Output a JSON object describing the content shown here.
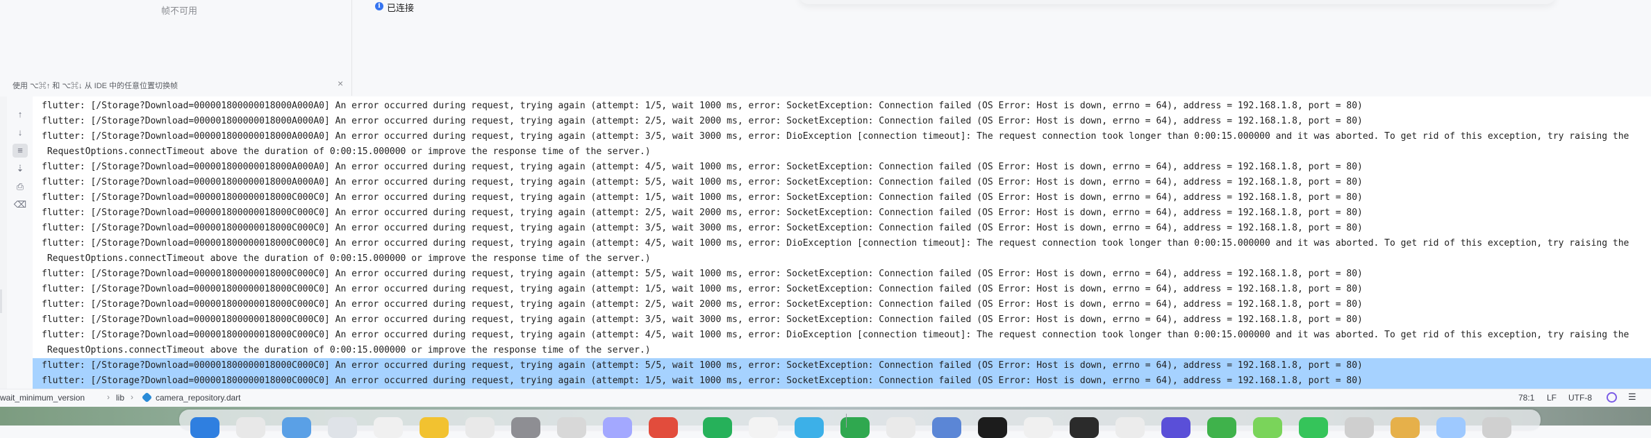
{
  "top_panel": {
    "frame_status": "帧不可用",
    "ide_hint": "使用 ⌥⌘↑ 和 ⌥⌘↓ 从 IDE 中的任意位置切换帧",
    "close_icon": "close-icon",
    "connection_status": "已连接",
    "info_icon": "info-icon"
  },
  "console_toolbar": [
    {
      "name": "scroll-up-icon",
      "glyph": "↑"
    },
    {
      "name": "scroll-down-icon",
      "glyph": "↓"
    },
    {
      "name": "soft-wrap-icon",
      "glyph": "≡"
    },
    {
      "name": "scroll-to-end-icon",
      "glyph": "⇣"
    },
    {
      "name": "print-icon",
      "glyph": "⎙"
    },
    {
      "name": "trash-icon",
      "glyph": "🗑"
    }
  ],
  "console": {
    "lines": [
      {
        "text": "flutter: [/Storage?Download=000001800000018000A000A0] An error occurred during request, trying again (attempt: 1/5, wait 1000 ms, error: SocketException: Connection failed (OS Error: Host is down, errno = 64), address = 192.168.1.8, port = 80)",
        "selected": false
      },
      {
        "text": "flutter: [/Storage?Download=000001800000018000A000A0] An error occurred during request, trying again (attempt: 2/5, wait 2000 ms, error: SocketException: Connection failed (OS Error: Host is down, errno = 64), address = 192.168.1.8, port = 80)",
        "selected": false
      },
      {
        "text": "flutter: [/Storage?Download=000001800000018000A000A0] An error occurred during request, trying again (attempt: 3/5, wait 3000 ms, error: DioException [connection timeout]: The request connection took longer than 0:00:15.000000 and it was aborted. To get rid of this exception, try raising the",
        "selected": false
      },
      {
        "text": " RequestOptions.connectTimeout above the duration of 0:00:15.000000 or improve the response time of the server.)",
        "selected": false
      },
      {
        "text": "flutter: [/Storage?Download=000001800000018000A000A0] An error occurred during request, trying again (attempt: 4/5, wait 1000 ms, error: SocketException: Connection failed (OS Error: Host is down, errno = 64), address = 192.168.1.8, port = 80)",
        "selected": false
      },
      {
        "text": "flutter: [/Storage?Download=000001800000018000A000A0] An error occurred during request, trying again (attempt: 5/5, wait 1000 ms, error: SocketException: Connection failed (OS Error: Host is down, errno = 64), address = 192.168.1.8, port = 80)",
        "selected": false
      },
      {
        "text": "flutter: [/Storage?Download=000001800000018000C000C0] An error occurred during request, trying again (attempt: 1/5, wait 1000 ms, error: SocketException: Connection failed (OS Error: Host is down, errno = 64), address = 192.168.1.8, port = 80)",
        "selected": false
      },
      {
        "text": "flutter: [/Storage?Download=000001800000018000C000C0] An error occurred during request, trying again (attempt: 2/5, wait 2000 ms, error: SocketException: Connection failed (OS Error: Host is down, errno = 64), address = 192.168.1.8, port = 80)",
        "selected": false
      },
      {
        "text": "flutter: [/Storage?Download=000001800000018000C000C0] An error occurred during request, trying again (attempt: 3/5, wait 3000 ms, error: SocketException: Connection failed (OS Error: Host is down, errno = 64), address = 192.168.1.8, port = 80)",
        "selected": false
      },
      {
        "text": "flutter: [/Storage?Download=000001800000018000C000C0] An error occurred during request, trying again (attempt: 4/5, wait 1000 ms, error: DioException [connection timeout]: The request connection took longer than 0:00:15.000000 and it was aborted. To get rid of this exception, try raising the",
        "selected": false
      },
      {
        "text": " RequestOptions.connectTimeout above the duration of 0:00:15.000000 or improve the response time of the server.)",
        "selected": false
      },
      {
        "text": "flutter: [/Storage?Download=000001800000018000C000C0] An error occurred during request, trying again (attempt: 5/5, wait 1000 ms, error: SocketException: Connection failed (OS Error: Host is down, errno = 64), address = 192.168.1.8, port = 80)",
        "selected": false
      },
      {
        "text": "flutter: [/Storage?Download=000001800000018000C000C0] An error occurred during request, trying again (attempt: 1/5, wait 1000 ms, error: SocketException: Connection failed (OS Error: Host is down, errno = 64), address = 192.168.1.8, port = 80)",
        "selected": false
      },
      {
        "text": "flutter: [/Storage?Download=000001800000018000C000C0] An error occurred during request, trying again (attempt: 2/5, wait 2000 ms, error: SocketException: Connection failed (OS Error: Host is down, errno = 64), address = 192.168.1.8, port = 80)",
        "selected": false
      },
      {
        "text": "flutter: [/Storage?Download=000001800000018000C000C0] An error occurred during request, trying again (attempt: 3/5, wait 3000 ms, error: SocketException: Connection failed (OS Error: Host is down, errno = 64), address = 192.168.1.8, port = 80)",
        "selected": false
      },
      {
        "text": "flutter: [/Storage?Download=000001800000018000C000C0] An error occurred during request, trying again (attempt: 4/5, wait 1000 ms, error: DioException [connection timeout]: The request connection took longer than 0:00:15.000000 and it was aborted. To get rid of this exception, try raising the",
        "selected": false
      },
      {
        "text": " RequestOptions.connectTimeout above the duration of 0:00:15.000000 or improve the response time of the server.)",
        "selected": false
      },
      {
        "text": "flutter: [/Storage?Download=000001800000018000C000C0] An error occurred during request, trying again (attempt: 5/5, wait 1000 ms, error: SocketException: Connection failed (OS Error: Host is down, errno = 64), address = 192.168.1.8, port = 80)",
        "selected": true
      },
      {
        "text": "flutter: [/Storage?Download=000001800000018000C000C0] An error occurred during request, trying again (attempt: 1/5, wait 1000 ms, error: SocketException: Connection failed (OS Error: Host is down, errno = 64), address = 192.168.1.8, port = 80)",
        "selected": true
      }
    ]
  },
  "statusbar": {
    "breadcrumb": [
      "wait_minimum_version",
      "lib",
      "camera_repository.dart"
    ],
    "separator": "›",
    "file_icon": "dart-file-icon",
    "cursor_position": "78:1",
    "line_separator": "LF",
    "encoding": "UTF-8",
    "ai_icon": "ai-assistant-icon",
    "menu_icon": "menu-icon"
  },
  "dock": {
    "icon_colors": [
      "#2f7fe0",
      "#e8e8e8",
      "#5aa0e6",
      "#dfe3e8",
      "#f0f0f0",
      "#f2c230",
      "#e9e9e9",
      "#8e8e93",
      "#d8d8d8",
      "#a3a8ff",
      "#e24c3c",
      "#26b15a",
      "#f3f3f3",
      "#3cb0e8",
      "#2fa84f",
      "#eaeaea",
      "#5b86d6",
      "#1c1c1c",
      "#f0f0f0",
      "#2b2b2b",
      "#ececec",
      "#5a4fd8",
      "#3fb24b",
      "#7ad45a",
      "#35c45a",
      "#cfcfcf",
      "#e6b04a",
      "#9ec9ff",
      "#d0d0d0"
    ]
  },
  "colors": {
    "selection": "#a6d2ff",
    "accent": "#3574f0"
  }
}
